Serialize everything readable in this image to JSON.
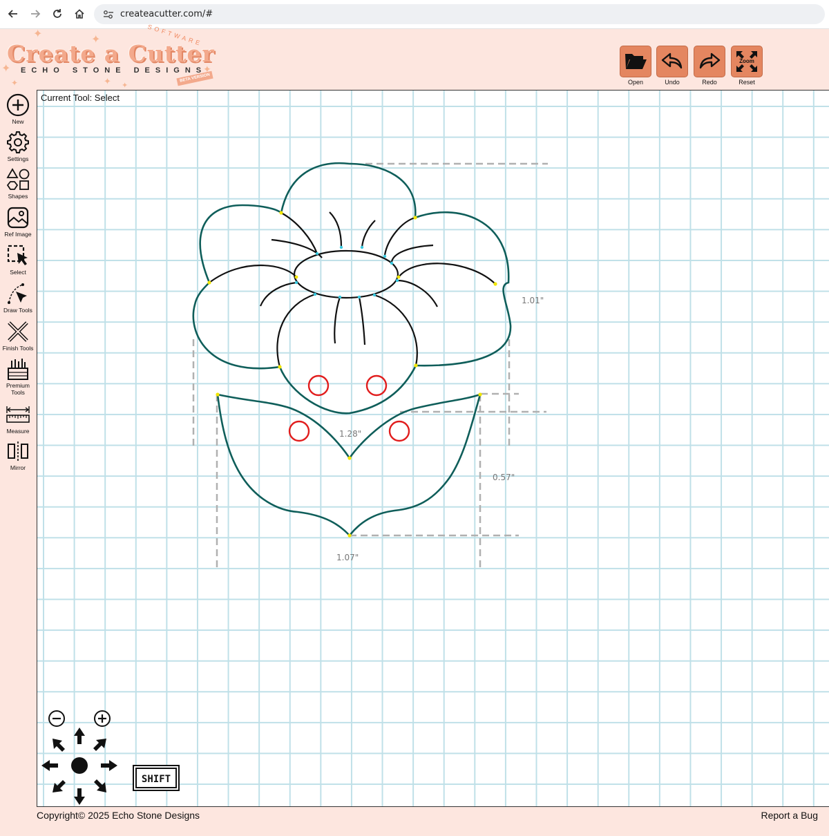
{
  "browser": {
    "url": "createacutter.com/#",
    "back_icon": "arrow-left-icon",
    "forward_icon": "arrow-right-icon",
    "reload_icon": "reload-icon",
    "home_icon": "home-icon"
  },
  "header": {
    "brand_name": "Create a Cutter",
    "brand_sub": "ECHO STONE DESIGNS",
    "brand_software": "SOFTWARE",
    "beta_tag": "BETA VERSION",
    "tools": [
      {
        "label": "Open",
        "icon": "folder-open-icon"
      },
      {
        "label": "Undo",
        "icon": "undo-icon"
      },
      {
        "label": "Redo",
        "icon": "redo-icon"
      },
      {
        "label": "Reset",
        "icon": "zoom-reset-icon",
        "icon_text": "Zoom"
      }
    ]
  },
  "sidebar": {
    "items": [
      {
        "label": "New",
        "icon": "plus-circle-icon"
      },
      {
        "label": "Settings",
        "icon": "gear-icon"
      },
      {
        "label": "Shapes",
        "icon": "shapes-icon"
      },
      {
        "label": "Ref Image",
        "icon": "image-icon"
      },
      {
        "label": "Select",
        "icon": "select-cursor-icon"
      },
      {
        "label": "Draw Tools",
        "icon": "pen-tool-icon"
      },
      {
        "label": "Finish Tools",
        "icon": "finish-tools-icon"
      },
      {
        "label": "Premium Tools",
        "icon": "premium-tools-icon"
      },
      {
        "label": "Measure",
        "icon": "ruler-icon"
      },
      {
        "label": "Mirror",
        "icon": "mirror-icon"
      }
    ]
  },
  "canvas": {
    "current_tool_label": "Current Tool: Select",
    "dimensions": {
      "flower_height": "1.01\"",
      "flower_width": "1.28\"",
      "leaf_height": "0.57\"",
      "leaf_width": "1.07\""
    },
    "colors": {
      "outline": "#0f5e5a",
      "detail": "#111111",
      "node": "#f2e600",
      "inner_node": "#36c9e0",
      "circle": "#e11d1d",
      "grid": "#bfe0e8",
      "accent": "#e48660"
    }
  },
  "controls": {
    "zoom_out_icon": "zoom-out-icon",
    "zoom_in_icon": "zoom-in-icon",
    "pan_icon": "pan-arrows-icon",
    "shift_label": "SHIFT"
  },
  "footer": {
    "copyright": "Copyright© 2025 Echo Stone Designs",
    "report_bug": "Report a Bug"
  }
}
